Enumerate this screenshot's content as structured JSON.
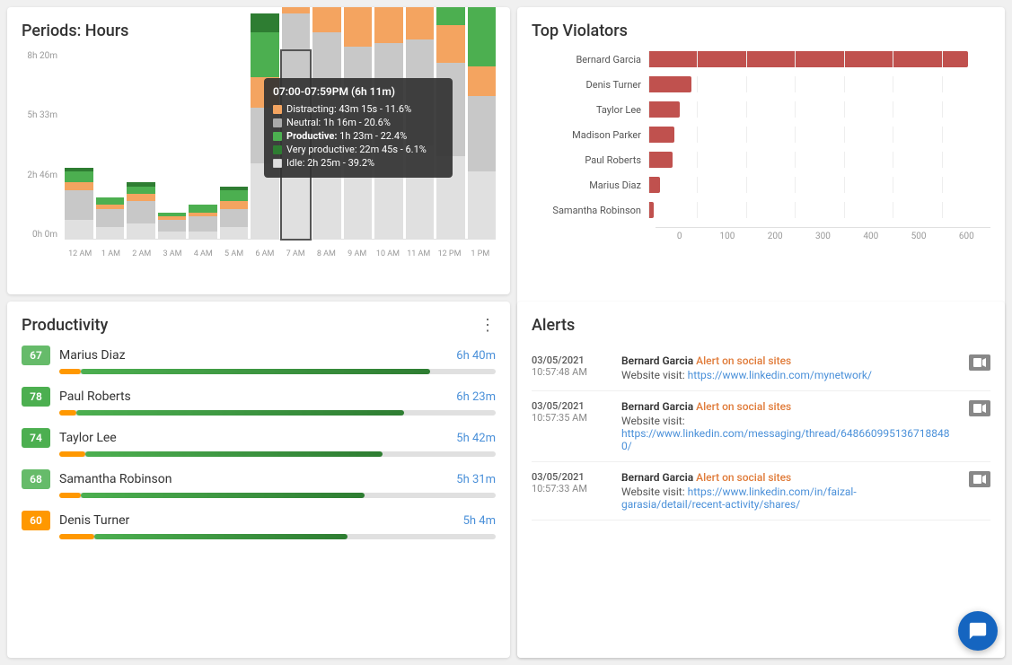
{
  "periods": {
    "title": "Periods: Hours",
    "y_labels": [
      "8h 20m",
      "5h 33m",
      "2h 46m",
      "0h 0m"
    ],
    "x_labels": [
      "12 AM",
      "1 AM",
      "2 AM",
      "3 AM",
      "4 AM",
      "5 AM",
      "6 AM",
      "7 AM",
      "8 AM",
      "9 AM",
      "10 AM",
      "11 AM",
      "12 PM",
      "1 PM"
    ],
    "tooltip": {
      "title": "07:00-07:59PM (6h 11m)",
      "rows": [
        {
          "label": "Distracting: 43m 15s - 11.6%",
          "color": "#f4a460"
        },
        {
          "label": "Neutral: 1h 16m - 20.6%",
          "color": "#aaa"
        },
        {
          "label": "Productive: 1h 23m - 22.4%",
          "color": "#4caf50"
        },
        {
          "label": "Very productive: 22m 45s - 6.1%",
          "color": "#2e7d32"
        },
        {
          "label": "Idle: 2h 25m - 39.2%",
          "color": "#e0e0e0"
        }
      ]
    }
  },
  "violators": {
    "title": "Top Violators",
    "items": [
      {
        "name": "Bernard Garcia",
        "value": 560,
        "max": 600
      },
      {
        "name": "Denis Turner",
        "value": 75,
        "max": 600
      },
      {
        "name": "Taylor Lee",
        "value": 55,
        "max": 600
      },
      {
        "name": "Madison Parker",
        "value": 45,
        "max": 600
      },
      {
        "name": "Paul Roberts",
        "value": 42,
        "max": 600
      },
      {
        "name": "Marius Diaz",
        "value": 20,
        "max": 600
      },
      {
        "name": "Samantha Robinson",
        "value": 10,
        "max": 600
      }
    ],
    "x_labels": [
      "0",
      "100",
      "200",
      "300",
      "400",
      "500",
      "600"
    ]
  },
  "productivity": {
    "title": "Productivity",
    "menu_label": "⋮",
    "items": [
      {
        "name": "Marius Diaz",
        "score": 67,
        "score_color": "#66bb6a",
        "time": "6h 40m",
        "bar_pct": 80,
        "orange_pct": 5
      },
      {
        "name": "Paul Roberts",
        "score": 78,
        "score_color": "#4caf50",
        "time": "6h 23m",
        "bar_pct": 75,
        "orange_pct": 4
      },
      {
        "name": "Taylor Lee",
        "score": 74,
        "score_color": "#4caf50",
        "time": "5h 42m",
        "bar_pct": 68,
        "orange_pct": 6
      },
      {
        "name": "Samantha Robinson",
        "score": 68,
        "score_color": "#66bb6a",
        "time": "5h 31m",
        "bar_pct": 65,
        "orange_pct": 5
      },
      {
        "name": "Denis Turner",
        "score": 60,
        "score_color": "#ff9800",
        "time": "5h 4m",
        "bar_pct": 58,
        "orange_pct": 8
      }
    ]
  },
  "alerts": {
    "title": "Alerts",
    "items": [
      {
        "date": "03/05/2021",
        "time": "10:57:48 AM",
        "person": "Bernard Garcia",
        "type": "Alert on social sites",
        "body": "Website visit: https://www.linkedin.com/mynetwork/"
      },
      {
        "date": "03/05/2021",
        "time": "10:57:35 AM",
        "person": "Bernard Garcia",
        "type": "Alert on social sites",
        "body": "Website visit: https://www.linkedin.com/messaging/thread/648660995136718848​0/"
      },
      {
        "date": "03/05/2021",
        "time": "10:57:33 AM",
        "person": "Bernard Garcia",
        "type": "Alert on social sites",
        "body": "Website visit: https://www.linkedin.com/in/faizal-garasia/detail/recent-activity/shares/"
      }
    ]
  }
}
